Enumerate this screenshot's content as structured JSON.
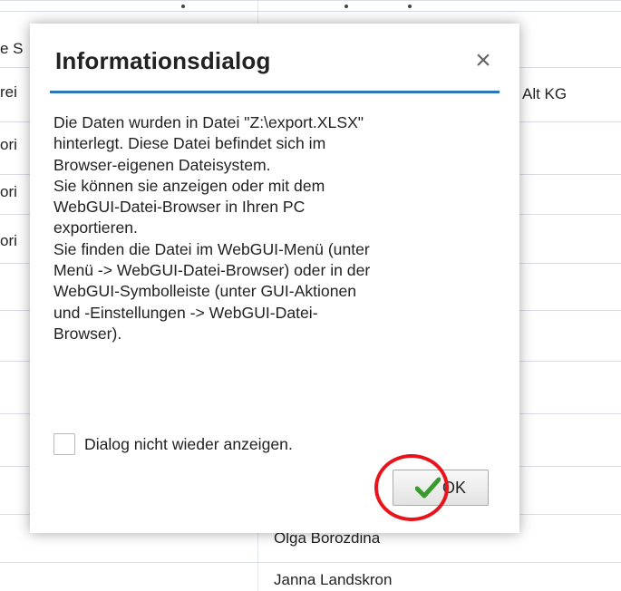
{
  "background": {
    "left_cells": [
      "e S",
      "rei",
      "ori",
      "ori",
      "ori"
    ],
    "right_cells": [
      "Alt KG",
      "Olga Borozdina",
      "Janna Landskron"
    ]
  },
  "dialog": {
    "title": "Informationsdialog",
    "close_label": "×",
    "body_lines": [
      "Die Daten wurden in Datei \"Z:\\export.XLSX\"",
      "hinterlegt. Diese Datei befindet sich im",
      "Browser-eigenen Dateisystem.",
      "Sie können sie anzeigen oder mit dem",
      "WebGUI-Datei-Browser in Ihren PC",
      "exportieren.",
      "Sie finden die Datei im WebGUI-Menü (unter",
      "Menü -> WebGUI-Datei-Browser) oder in der",
      "WebGUI-Symbolleiste (unter GUI-Aktionen",
      "und -Einstellungen -> WebGUI-Datei-",
      "Browser)."
    ],
    "checkbox_label": "Dialog nicht wieder anzeigen.",
    "checkbox_checked": false,
    "ok_label": "OK",
    "ok_icon": "checkmark-icon"
  },
  "colors": {
    "header_line": "#2c78b5",
    "ok_check": "#3a9a2f",
    "annotation": "#e8141b"
  }
}
